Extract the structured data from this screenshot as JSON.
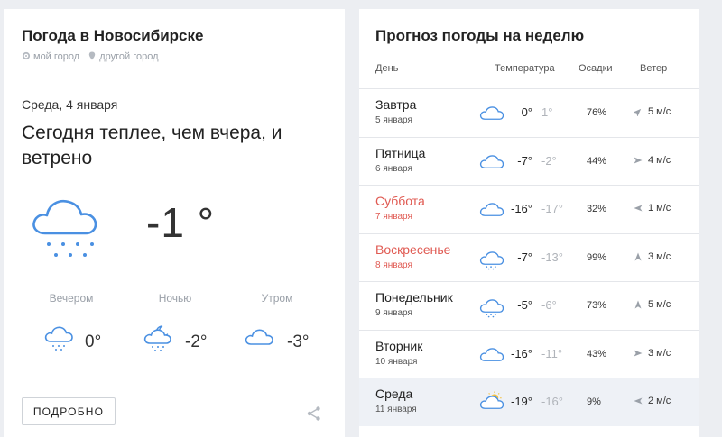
{
  "today": {
    "title": "Погода в Новосибирске",
    "links": [
      "мой город",
      "другой город"
    ],
    "date": "Среда, 4 января",
    "headline": "Сегодня теплее, чем вчера, и ветрено",
    "current_temp": "-1 °",
    "current_icon": "cloud-snow-icon",
    "parts": [
      {
        "label": "Вечером",
        "temp": "0°",
        "icon": "cloud-snow-icon"
      },
      {
        "label": "Ночью",
        "temp": "-2°",
        "icon": "moon-cloud-snow-icon"
      },
      {
        "label": "Утром",
        "temp": "-3°",
        "icon": "cloud-icon"
      }
    ],
    "detail_button": "ПОДРОБНО"
  },
  "week": {
    "title": "Прогноз погоды на неделю",
    "headers": {
      "day": "День",
      "temp": "Температура",
      "precip": "Осадки",
      "wind": "Ветер"
    },
    "rows": [
      {
        "day": "Завтра",
        "date": "5 января",
        "icon": "cloud-icon",
        "t_day": "0°",
        "t_night": "1°",
        "precip": "76%",
        "wind": "5 м/с",
        "wind_dir": "north-east",
        "weekend": false
      },
      {
        "day": "Пятница",
        "date": "6 января",
        "icon": "cloud-icon",
        "t_day": "-7°",
        "t_night": "-2°",
        "precip": "44%",
        "wind": "4 м/с",
        "wind_dir": "east",
        "weekend": false
      },
      {
        "day": "Суббота",
        "date": "7 января",
        "icon": "cloud-icon",
        "t_day": "-16°",
        "t_night": "-17°",
        "precip": "32%",
        "wind": "1 м/с",
        "wind_dir": "west",
        "weekend": true
      },
      {
        "day": "Воскресенье",
        "date": "8 января",
        "icon": "cloud-snow-icon",
        "t_day": "-7°",
        "t_night": "-13°",
        "precip": "99%",
        "wind": "3 м/с",
        "wind_dir": "north",
        "weekend": true
      },
      {
        "day": "Понедельник",
        "date": "9 января",
        "icon": "cloud-snow-icon",
        "t_day": "-5°",
        "t_night": "-6°",
        "precip": "73%",
        "wind": "5 м/с",
        "wind_dir": "north",
        "weekend": false
      },
      {
        "day": "Вторник",
        "date": "10 января",
        "icon": "cloud-icon",
        "t_day": "-16°",
        "t_night": "-11°",
        "precip": "43%",
        "wind": "3 м/с",
        "wind_dir": "east",
        "weekend": false
      },
      {
        "day": "Среда",
        "date": "11 января",
        "icon": "sun-cloud-icon",
        "t_day": "-19°",
        "t_night": "-16°",
        "precip": "9%",
        "wind": "2 м/с",
        "wind_dir": "west",
        "weekend": false,
        "today": true
      }
    ]
  },
  "colors": {
    "weekend": "#e05a52",
    "icon_blue": "#4a90e2",
    "today_row": "#eef1f6"
  }
}
